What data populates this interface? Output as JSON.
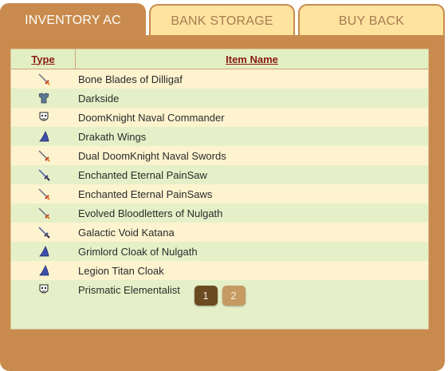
{
  "tabs": [
    {
      "label": "INVENTORY AC",
      "active": true
    },
    {
      "label": "BANK STORAGE",
      "active": false
    },
    {
      "label": "BUY BACK",
      "active": false
    }
  ],
  "table": {
    "headers": {
      "type": "Type",
      "name": "Item Name"
    },
    "rows": [
      {
        "icon": "sword-icon",
        "name": "Bone Blades of Dilligaf"
      },
      {
        "icon": "armor-icon",
        "name": "Darkside"
      },
      {
        "icon": "mask-icon",
        "name": "DoomKnight Naval Commander"
      },
      {
        "icon": "cape-icon",
        "name": "Drakath Wings"
      },
      {
        "icon": "sword-icon",
        "name": "Dual DoomKnight Naval Swords"
      },
      {
        "icon": "blade-icon",
        "name": "Enchanted Eternal PainSaw"
      },
      {
        "icon": "sword-icon",
        "name": "Enchanted Eternal PainSaws"
      },
      {
        "icon": "sword-icon",
        "name": "Evolved Bloodletters of Nulgath"
      },
      {
        "icon": "blade-icon",
        "name": "Galactic Void Katana"
      },
      {
        "icon": "cape-icon",
        "name": "Grimlord Cloak of Nulgath"
      },
      {
        "icon": "cape-icon",
        "name": "Legion Titan Cloak"
      },
      {
        "icon": "mask-icon",
        "name": "Prismatic Elementalist"
      }
    ]
  },
  "pagination": {
    "pages": [
      "1",
      "2"
    ],
    "current": "1"
  },
  "colors": {
    "panel": "#c98b4d",
    "tab_inactive": "#fde39e",
    "header_text": "#8a1a12",
    "row_odd": "#fdf3cf",
    "row_even": "#e6f0c8"
  }
}
